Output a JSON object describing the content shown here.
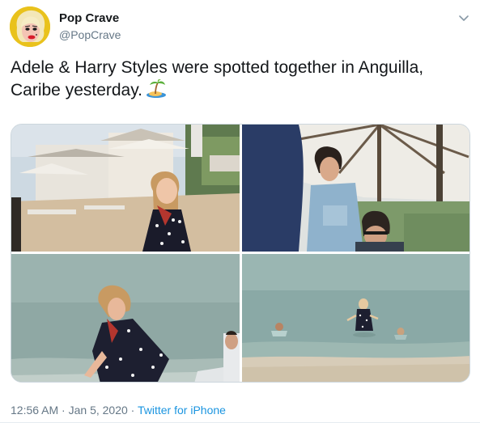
{
  "author": {
    "name": "Pop Crave",
    "handle": "@PopCrave",
    "avatar_icon": "pop-art-portrait-avatar"
  },
  "tweet": {
    "text": "Adele & Harry Styles were spotted together in Anguilla, Caribe yesterday.",
    "emoji": "desert-island-emoji"
  },
  "media": {
    "photos": [
      {
        "subject": "beach-resort-photo"
      },
      {
        "subject": "umbrella-cafe-photo"
      },
      {
        "subject": "wading-in-sea-photo"
      },
      {
        "subject": "swimming-in-sea-photo"
      }
    ]
  },
  "meta": {
    "time": "12:56 AM",
    "separator": " · ",
    "date": "Jan 5, 2020",
    "separator2": " · ",
    "source": "Twitter for iPhone"
  },
  "colors": {
    "name": "#14171a",
    "secondary": "#657786",
    "link": "#1b95e0",
    "border": "#ccd6dd"
  }
}
